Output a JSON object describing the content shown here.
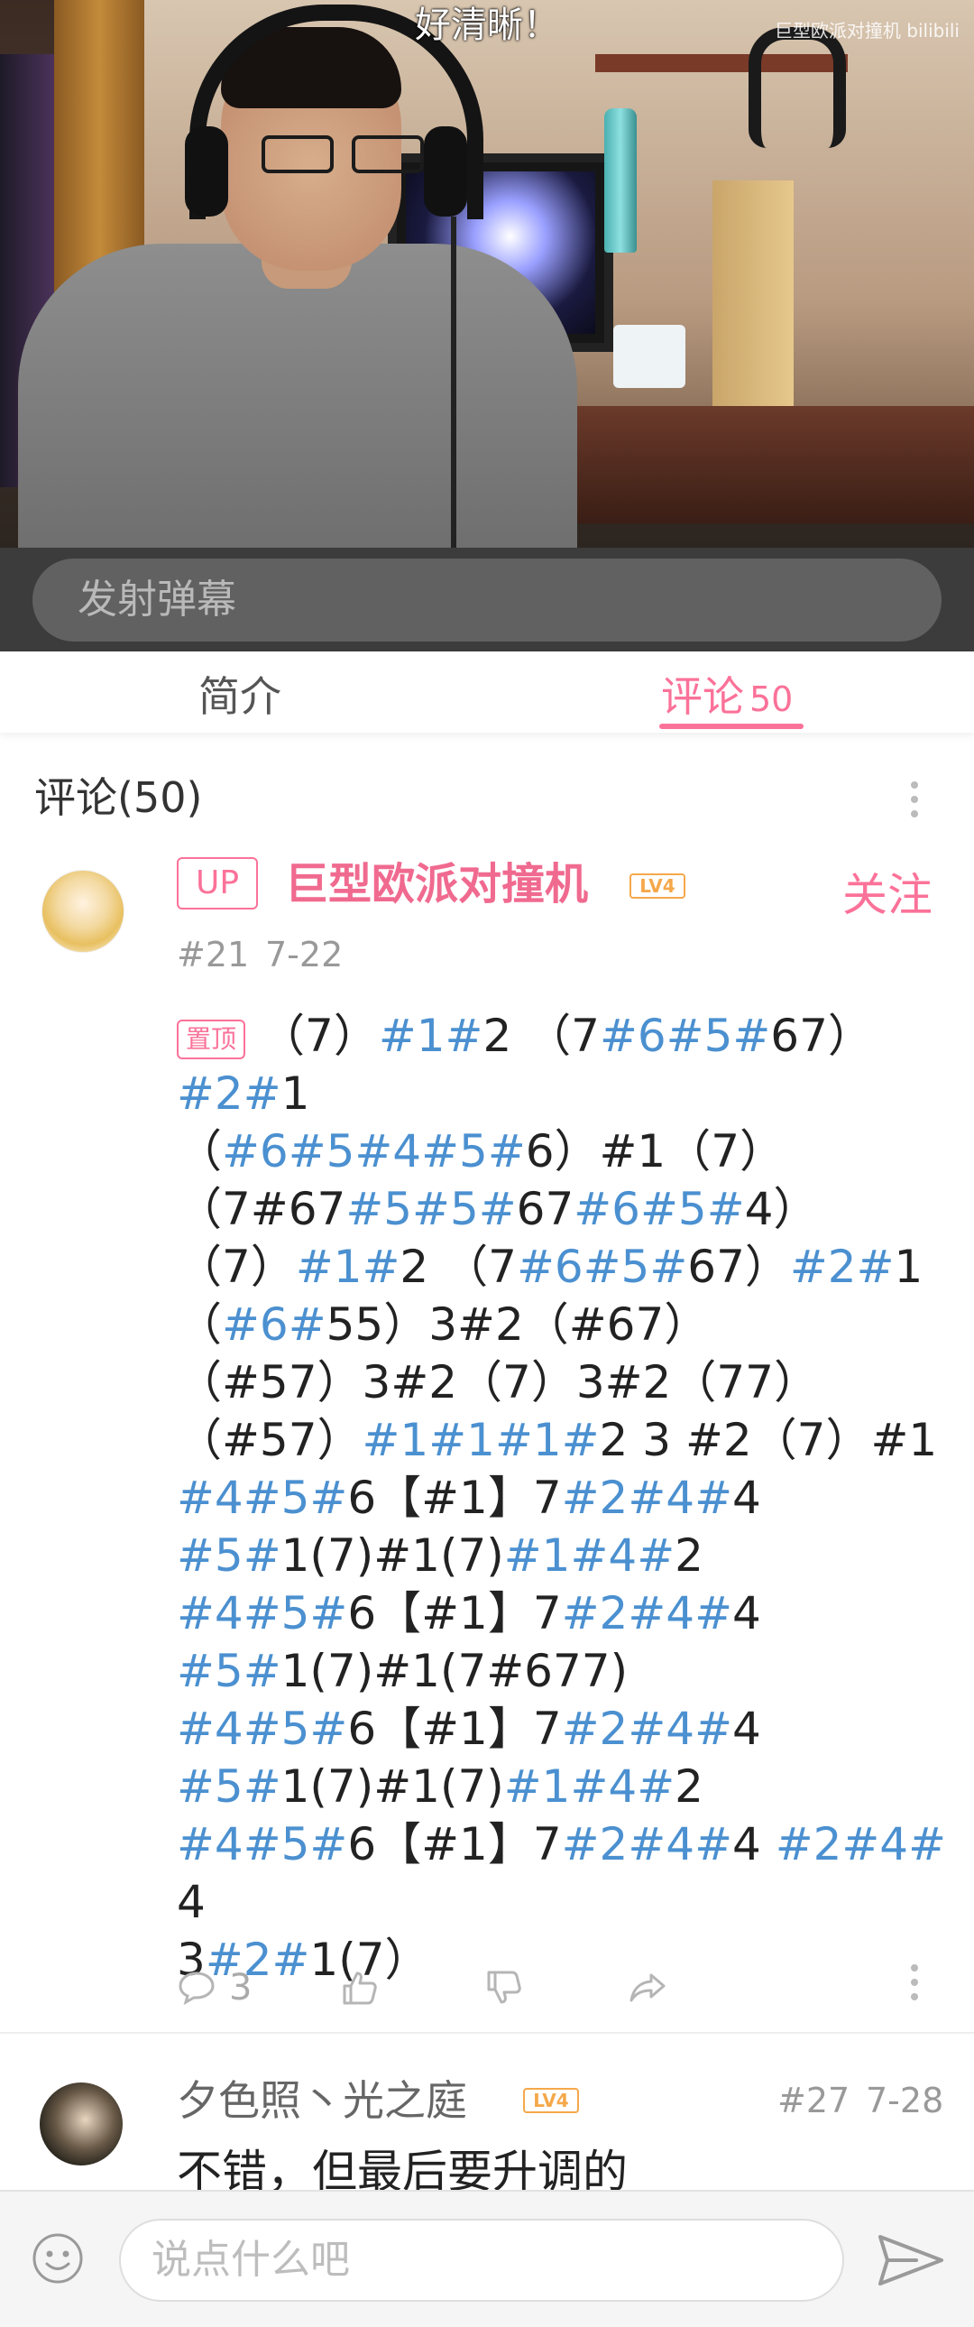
{
  "video": {
    "danmaku_text": "好清晰！",
    "watermark": "巨型欧派对撞机 bilibili",
    "danmaku_input_placeholder": "发射弹幕"
  },
  "tabs": [
    {
      "label": "简介",
      "active": false
    },
    {
      "label": "评论",
      "count": "50",
      "active": true
    }
  ],
  "comments_header": {
    "title": "评论(50)"
  },
  "comments": [
    {
      "badge": "UP",
      "username": "巨型欧派对撞机",
      "level": "LV4",
      "follow_label": "关注",
      "floor": "#21",
      "date": "7-22",
      "pin_label": "置顶",
      "text_lines": [
        "（7）#1#2 （7#6#5#67）",
        "#2#1",
        "（#6#5#4#5#6）#1（7）",
        "（7#67#5#5#67#6#5#4）",
        "（7）#1#2 （7#6#5#67）#2#1",
        "（#6#55）3#2（#67）",
        "（#57）3#2（7）3#2（77）",
        "（#57）#1#1#1#2 3 #2（7）#1",
        "#4#5#6【#1】7#2#4#4",
        "#5#1(7)#1(7)#1#4#2",
        "#4#5#6【#1】7#2#4#4",
        "#5#1(7)#1(7#677)",
        "#4#5#6【#1】7#2#4#4",
        "#5#1(7)#1(7)#1#4#2",
        "#4#5#6【#1】7#2#4#4 #2#4#4",
        "3#2#1(7）"
      ],
      "reply_count": "3"
    },
    {
      "username": "夕色照丶光之庭",
      "level": "LV4",
      "floor": "#27",
      "date": "7-28",
      "text": "不错，但最后要升调的"
    }
  ],
  "bottom_bar": {
    "input_placeholder": "说点什么吧"
  },
  "colors": {
    "accent": "#fb7299",
    "highlight": "#4b90d0",
    "level": "#f5a84a"
  }
}
